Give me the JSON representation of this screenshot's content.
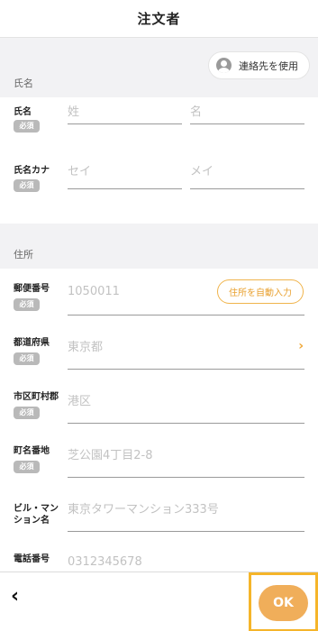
{
  "header": {
    "title": "注文者"
  },
  "name_section": {
    "label": "氏名",
    "contact_button": "連絡先を使用",
    "rows": [
      {
        "label": "氏名",
        "required": "必須",
        "placeholders": [
          "姓",
          "名"
        ]
      },
      {
        "label": "氏名カナ",
        "required": "必須",
        "placeholders": [
          "セイ",
          "メイ"
        ]
      }
    ]
  },
  "address_section": {
    "label": "住所",
    "rows": [
      {
        "label": "郵便番号",
        "required": "必須",
        "placeholder": "1050011",
        "action": "住所を自動入力"
      },
      {
        "label": "都道府県",
        "required": "必須",
        "placeholder": "東京都"
      },
      {
        "label": "市区町村郡",
        "required": "必須",
        "placeholder": "港区"
      },
      {
        "label": "町名番地",
        "required": "必須",
        "placeholder": "芝公園4丁目2-8"
      },
      {
        "label_line1": "ビル・マン",
        "label_line2": "ション名",
        "placeholder": "東京タワーマンション333号"
      },
      {
        "label": "電話番号",
        "placeholder": "0312345678"
      }
    ]
  },
  "footer": {
    "back": "‹",
    "ok": "OK"
  }
}
